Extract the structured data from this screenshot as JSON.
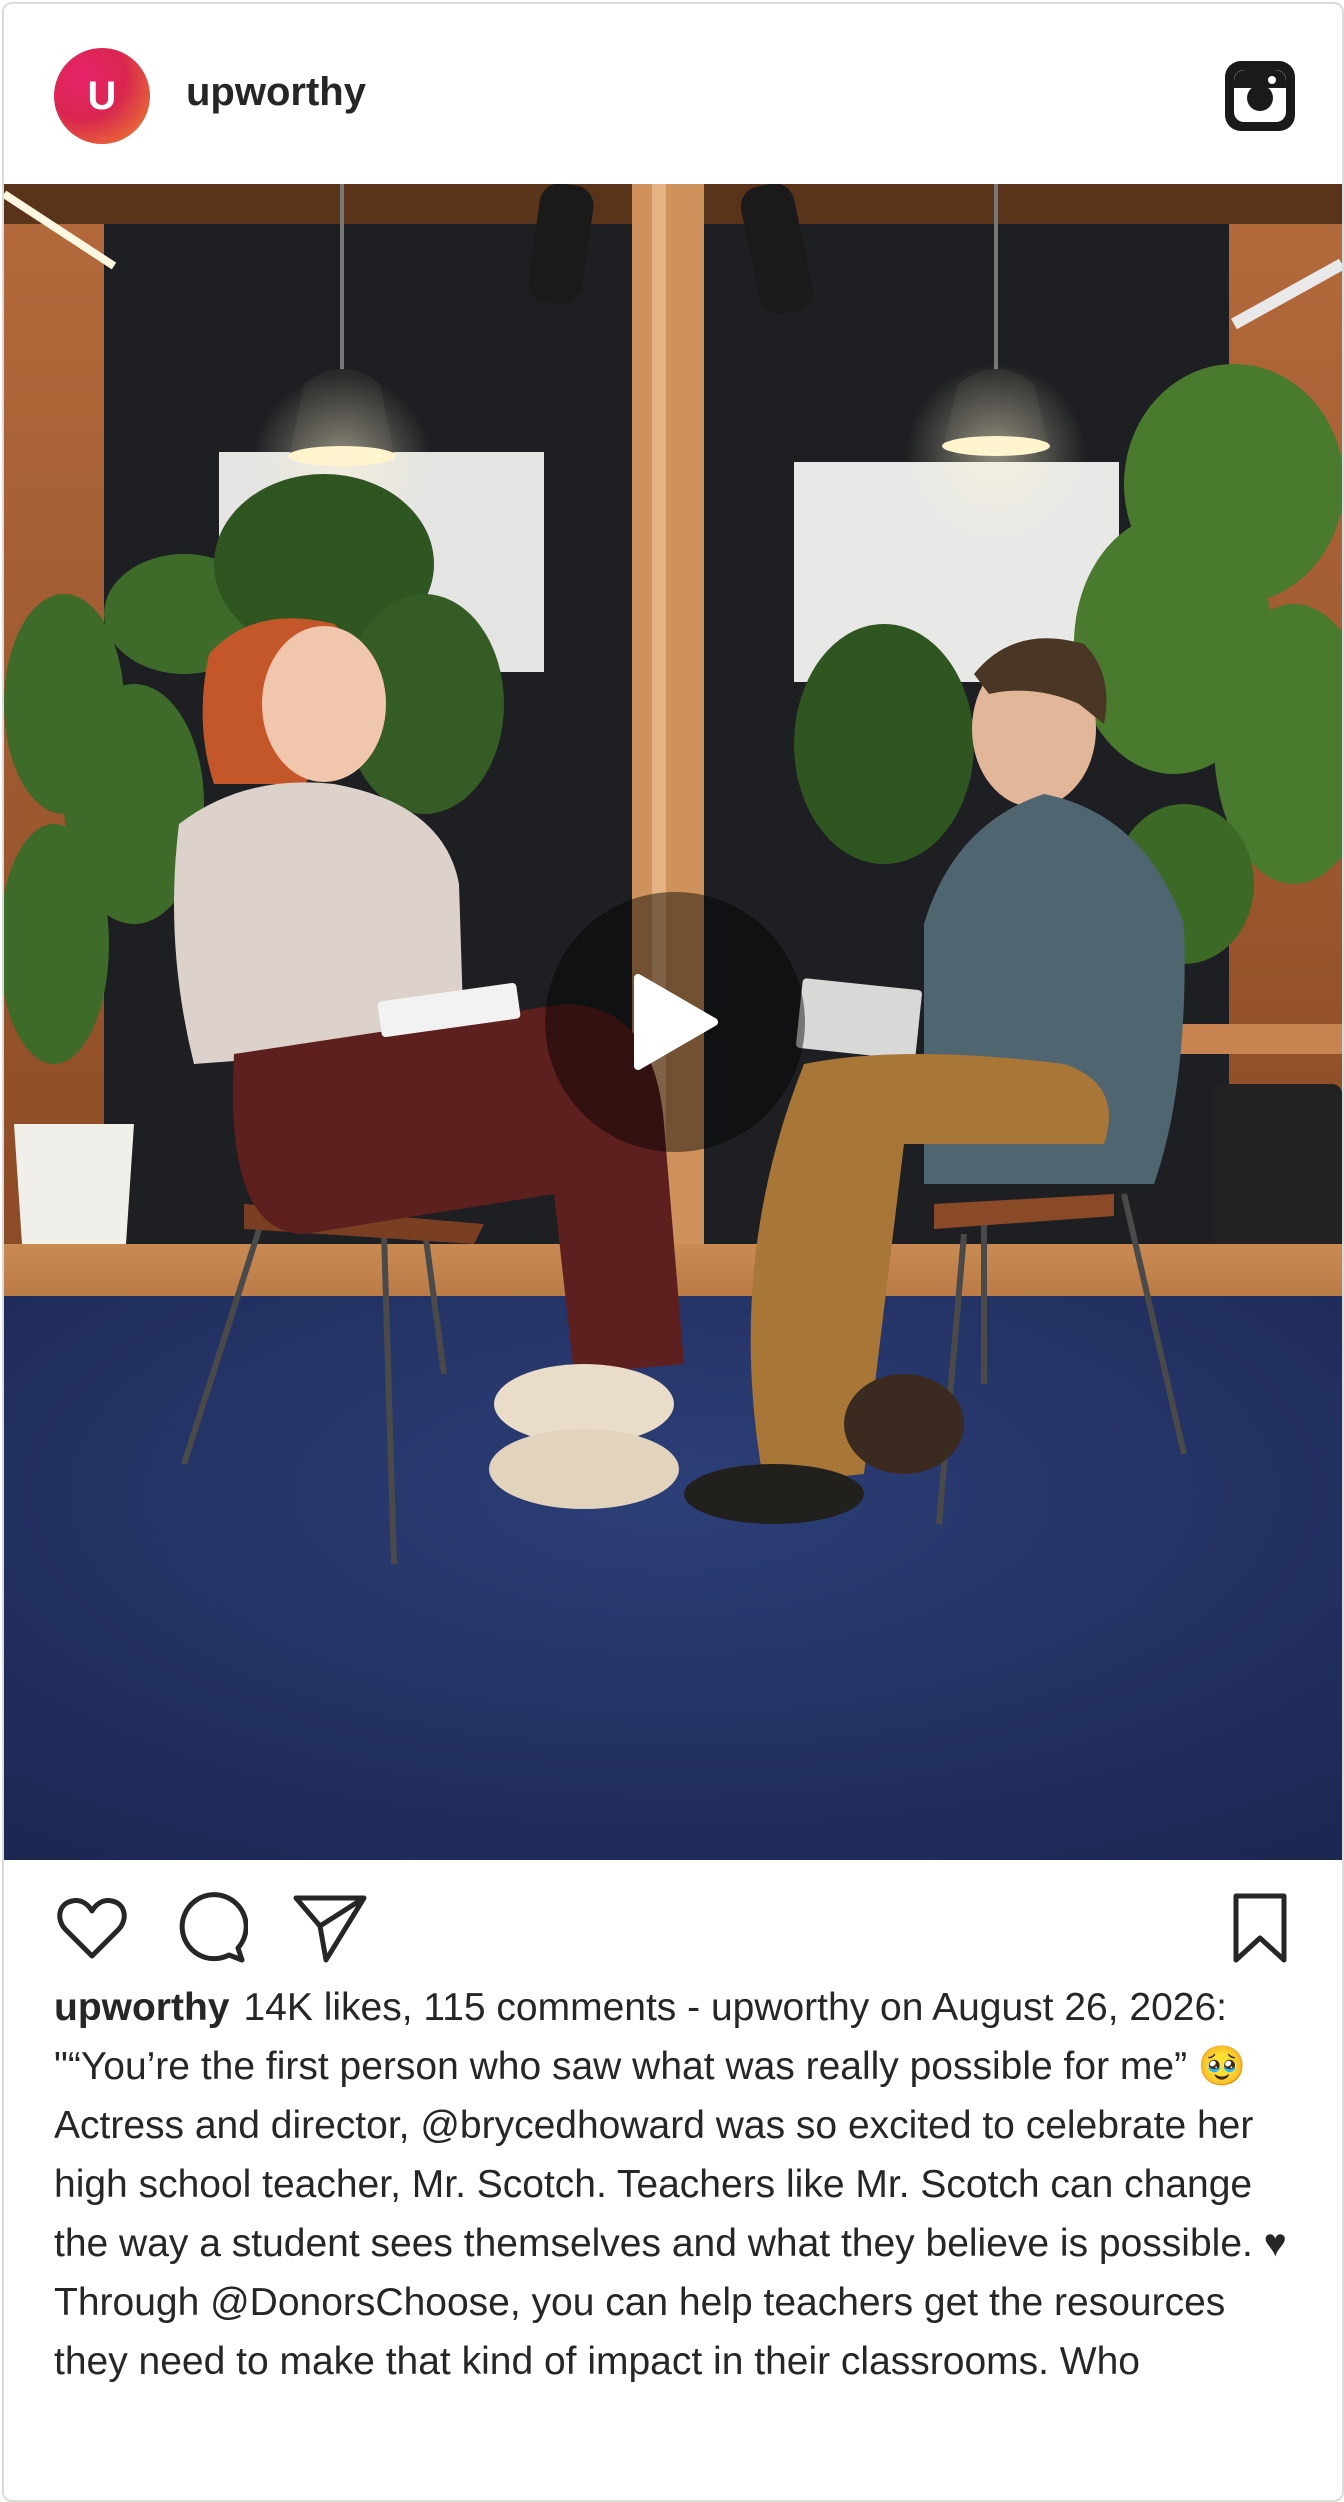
{
  "post": {
    "avatar_letter": "U",
    "username": "upworthy",
    "header_icon": "instagram-logo-icon",
    "media_alt": "Woman with red hair and man with glasses laughing while seated on chairs on a blue rug in a wood-paneled studio with plants and pendant lamps",
    "play_icon": "play-icon",
    "actions": {
      "like_icon": "heart-icon",
      "comment_icon": "comment-icon",
      "share_icon": "send-icon",
      "save_icon": "bookmark-icon"
    },
    "caption": {
      "username": "upworthy",
      "text": "14K likes, 115 comments - upworthy on August 26, 2026: \"“You’re the first person who saw what was really possible for me” 🥹 Actress and director, @brycedhoward was so excited to celebrate her high school teacher, Mr. Scotch. Teachers like Mr. Scotch can change the way a student sees themselves and what they believe is possible. ♥ Through @DonorsChoose, you can help teachers get the resources they need to make that kind of impact in their classrooms. Who"
    }
  }
}
